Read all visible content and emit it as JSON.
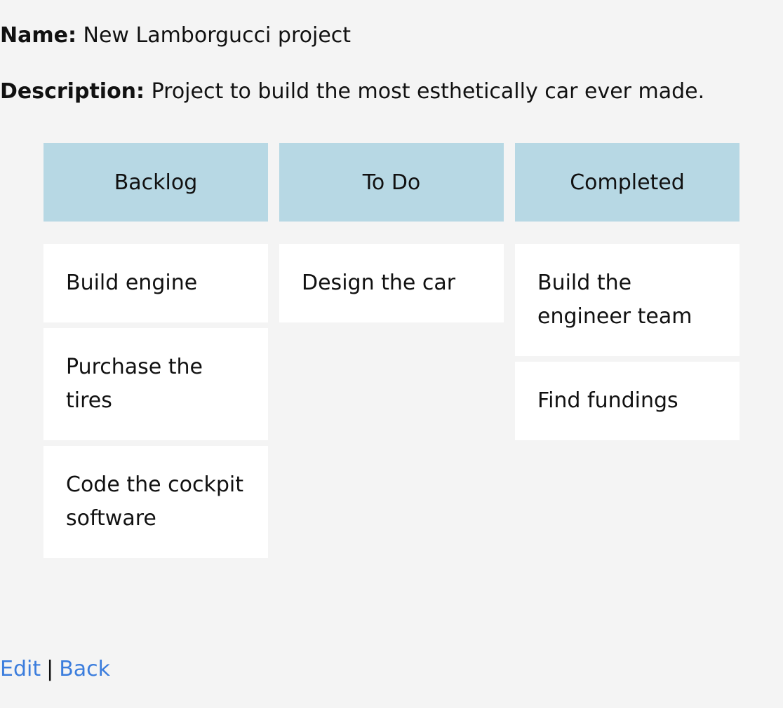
{
  "project": {
    "name_label": "Name:",
    "name_value": "New Lamborgucci project",
    "description_label": "Description:",
    "description_value": "Project to build the most esthetically car ever made."
  },
  "board": {
    "columns": [
      {
        "title": "Backlog",
        "cards": [
          "Build engine",
          "Purchase the tires",
          "Code the cockpit software"
        ]
      },
      {
        "title": "To Do",
        "cards": [
          "Design the car"
        ]
      },
      {
        "title": "Completed",
        "cards": [
          "Build the engineer team",
          "Find fundings"
        ]
      }
    ]
  },
  "footer": {
    "edit_label": "Edit",
    "separator": "|",
    "back_label": "Back"
  },
  "colors": {
    "background": "#f4f4f4",
    "column_header": "#b7d8e4",
    "card": "#ffffff",
    "link": "#3b7ddd"
  }
}
